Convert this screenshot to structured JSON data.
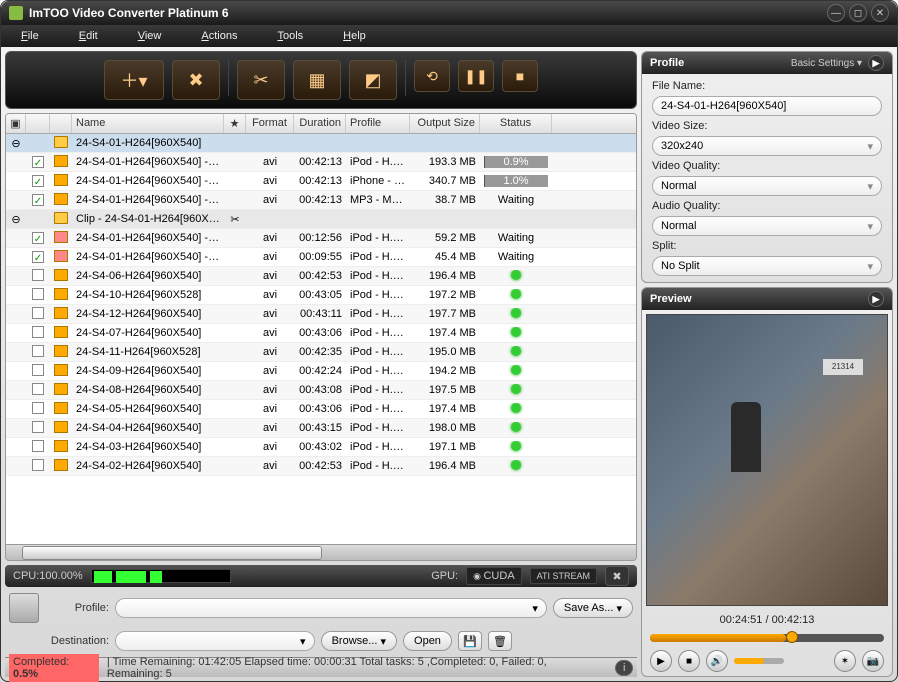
{
  "app": {
    "title": "ImTOO Video Converter Platinum 6"
  },
  "menu": {
    "file": "File",
    "edit": "Edit",
    "view": "View",
    "actions": "Actions",
    "tools": "Tools",
    "help": "Help"
  },
  "columns": {
    "name": "Name",
    "format": "Format",
    "duration": "Duration",
    "profile": "Profile",
    "output_size": "Output Size",
    "status": "Status"
  },
  "rows": [
    {
      "type": "group",
      "name": "24-S4-01-H264[960X540]",
      "expand": "⊖",
      "sel": true
    },
    {
      "type": "item",
      "chk": true,
      "name": "24-S4-01-H264[960X540] - iP...",
      "fmt": "avi",
      "dur": "00:42:13",
      "profile": "iPod - H.2...",
      "size": "193.3 MB",
      "status_pct": "0.9%"
    },
    {
      "type": "item",
      "chk": true,
      "name": "24-S4-01-H264[960X540] - iP...",
      "fmt": "avi",
      "dur": "00:42:13",
      "profile": "iPhone - H...",
      "size": "340.7 MB",
      "status_pct": "1.0%"
    },
    {
      "type": "item",
      "chk": true,
      "name": "24-S4-01-H264[960X540] - M...",
      "fmt": "avi",
      "dur": "00:42:13",
      "profile": "MP3 - MP...",
      "size": "38.7 MB",
      "status": "Waiting"
    },
    {
      "type": "group",
      "name": "Clip - 24-S4-01-H264[960X540]",
      "expand": "⊖",
      "star": "✂"
    },
    {
      "type": "item",
      "chk": true,
      "ico": "cut",
      "name": "24-S4-01-H264[960X540] - S...",
      "fmt": "avi",
      "dur": "00:12:56",
      "profile": "iPod - H.2...",
      "size": "59.2 MB",
      "status": "Waiting"
    },
    {
      "type": "item",
      "chk": true,
      "ico": "cut",
      "name": "24-S4-01-H264[960X540] - S...",
      "fmt": "avi",
      "dur": "00:09:55",
      "profile": "iPod - H.2...",
      "size": "45.4 MB",
      "status": "Waiting"
    },
    {
      "type": "item",
      "chk": false,
      "name": "24-S4-06-H264[960X540]",
      "fmt": "avi",
      "dur": "00:42:53",
      "profile": "iPod - H.2...",
      "size": "196.4 MB",
      "status_dot": true
    },
    {
      "type": "item",
      "chk": false,
      "name": "24-S4-10-H264[960X528]",
      "fmt": "avi",
      "dur": "00:43:05",
      "profile": "iPod - H.2...",
      "size": "197.2 MB",
      "status_dot": true
    },
    {
      "type": "item",
      "chk": false,
      "name": "24-S4-12-H264[960X540]",
      "fmt": "avi",
      "dur": "00:43:11",
      "profile": "iPod - H.2...",
      "size": "197.7 MB",
      "status_dot": true
    },
    {
      "type": "item",
      "chk": false,
      "name": "24-S4-07-H264[960X540]",
      "fmt": "avi",
      "dur": "00:43:06",
      "profile": "iPod - H.2...",
      "size": "197.4 MB",
      "status_dot": true
    },
    {
      "type": "item",
      "chk": false,
      "name": "24-S4-11-H264[960X528]",
      "fmt": "avi",
      "dur": "00:42:35",
      "profile": "iPod - H.2...",
      "size": "195.0 MB",
      "status_dot": true
    },
    {
      "type": "item",
      "chk": false,
      "name": "24-S4-09-H264[960X540]",
      "fmt": "avi",
      "dur": "00:42:24",
      "profile": "iPod - H.2...",
      "size": "194.2 MB",
      "status_dot": true
    },
    {
      "type": "item",
      "chk": false,
      "name": "24-S4-08-H264[960X540]",
      "fmt": "avi",
      "dur": "00:43:08",
      "profile": "iPod - H.2...",
      "size": "197.5 MB",
      "status_dot": true
    },
    {
      "type": "item",
      "chk": false,
      "name": "24-S4-05-H264[960X540]",
      "fmt": "avi",
      "dur": "00:43:06",
      "profile": "iPod - H.2...",
      "size": "197.4 MB",
      "status_dot": true
    },
    {
      "type": "item",
      "chk": false,
      "name": "24-S4-04-H264[960X540]",
      "fmt": "avi",
      "dur": "00:43:15",
      "profile": "iPod - H.2...",
      "size": "198.0 MB",
      "status_dot": true
    },
    {
      "type": "item",
      "chk": false,
      "name": "24-S4-03-H264[960X540]",
      "fmt": "avi",
      "dur": "00:43:02",
      "profile": "iPod - H.2...",
      "size": "197.1 MB",
      "status_dot": true
    },
    {
      "type": "item",
      "chk": false,
      "name": "24-S4-02-H264[960X540]",
      "fmt": "avi",
      "dur": "00:42:53",
      "profile": "iPod - H.2...",
      "size": "196.4 MB",
      "status_dot": true
    }
  ],
  "cpu": {
    "label": "CPU:100.00%"
  },
  "gpu": {
    "label": "GPU:",
    "cuda": "CUDA",
    "ati": "ATI STREAM"
  },
  "bottom": {
    "profile_label": "Profile:",
    "saveas": "Save As...",
    "dest_label": "Destination:",
    "browse": "Browse...",
    "open": "Open"
  },
  "status": {
    "completed_label": "Completed:",
    "completed_pct": "0.5%",
    "text": "| Time Remaining: 01:42:05 Elapsed time: 00:00:31 Total tasks: 5 ,Completed: 0, Failed: 0, Remaining: 5"
  },
  "profile_panel": {
    "title": "Profile",
    "settings": "Basic Settings ▾",
    "filename_label": "File Name:",
    "filename": "24-S4-01-H264[960X540]",
    "videosize_label": "Video Size:",
    "videosize": "320x240",
    "videoq_label": "Video Quality:",
    "videoq": "Normal",
    "audioq_label": "Audio Quality:",
    "audioq": "Normal",
    "split_label": "Split:",
    "split": "No Split"
  },
  "preview": {
    "title": "Preview",
    "sign": "21314",
    "time": "00:24:51 / 00:42:13"
  }
}
